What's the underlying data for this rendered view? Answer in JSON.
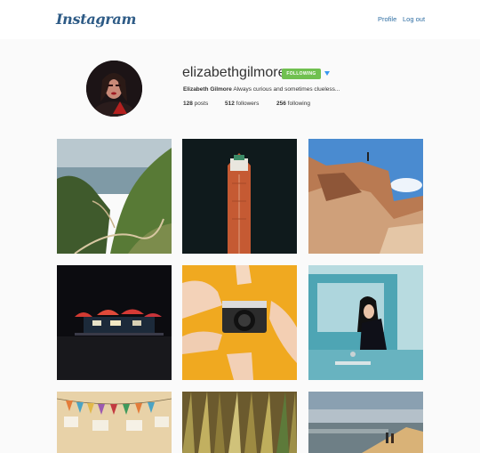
{
  "header": {
    "logo": "Instagram",
    "nav_profile": "Profile",
    "nav_logout": "Log out"
  },
  "profile": {
    "username": "elizabethgilmore",
    "follow_button": "FOLLOWING",
    "full_name": "Elizabeth Gilmore",
    "bio": "Always curious and sometimes clueless...",
    "posts_count": "128",
    "posts_label": "posts",
    "followers_count": "512",
    "followers_label": "followers",
    "following_count": "256",
    "following_label": "following"
  },
  "grid": {
    "posts": [
      {
        "subject": "coastal cliffs and ocean"
      },
      {
        "subject": "aerial view of red ship"
      },
      {
        "subject": "sandstone rock formation"
      },
      {
        "subject": "illuminated tents at night"
      },
      {
        "subject": "hands holding camera"
      },
      {
        "subject": "woman in vintage car"
      },
      {
        "subject": "paper garland decorations"
      },
      {
        "subject": "dry grass close-up"
      },
      {
        "subject": "hikers overlooking city"
      }
    ]
  },
  "colors": {
    "accent": "#70c050",
    "link": "#2f6ea3",
    "logo": "#2e5b86"
  }
}
